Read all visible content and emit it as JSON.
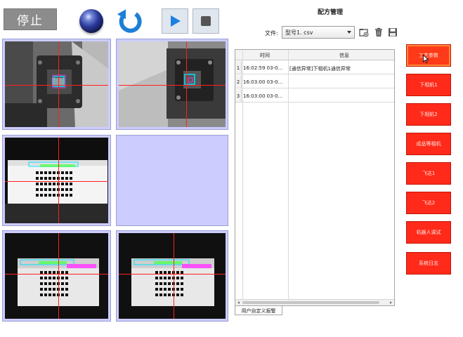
{
  "toolbar": {
    "stop_label": "停止",
    "status_icon": "status-ball-icon",
    "refresh_icon": "refresh-icon",
    "play_icon": "play-icon",
    "stop_icon": "stop-square-icon",
    "accent_blue": "#1e7fd8"
  },
  "cameras": {
    "cam1_label": "",
    "cam2_label": "",
    "cam3_label": "",
    "cam4_label": "",
    "cam5_label": "",
    "crosshair_color": "#ff2020",
    "frame_color": "#ccccff"
  },
  "recipe": {
    "title": "配方管理",
    "file_label": "文件:",
    "file_value": "型号1. csv",
    "icons": [
      "new-file-icon",
      "delete-icon",
      "save-icon"
    ]
  },
  "table": {
    "columns": [
      "时间",
      "信息"
    ],
    "rows": [
      {
        "num": "1",
        "time": "16:02:59 03-0...",
        "message": "[通信异常]下相机1通信异常"
      },
      {
        "num": "2",
        "time": "16:03:00 03-0...",
        "message": ""
      },
      {
        "num": "3",
        "time": "16:03:00 03-0...",
        "message": ""
      }
    ]
  },
  "alarm_tab": "用户自定义报警",
  "buttons": [
    {
      "label": "工艺参数",
      "active": true
    },
    {
      "label": "下相机1",
      "active": false
    },
    {
      "label": "下相机2",
      "active": false
    },
    {
      "label": "成品等相机",
      "active": false
    },
    {
      "label": "飞达1",
      "active": false
    },
    {
      "label": "飞达2",
      "active": false
    },
    {
      "label": "机器人调试",
      "active": false
    },
    {
      "label": "系统日志",
      "active": false
    }
  ],
  "colors": {
    "button_red": "#ff2a1a",
    "stop_gray": "#8c8c8c"
  }
}
